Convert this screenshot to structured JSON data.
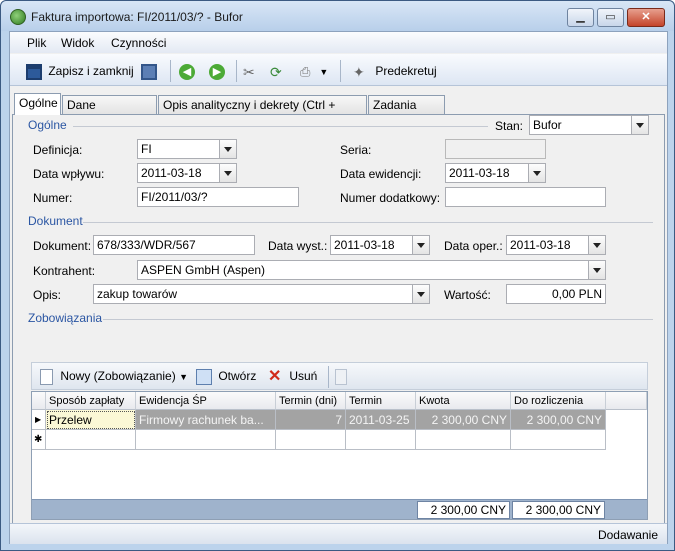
{
  "window": {
    "title": "Faktura importowa: FI/2011/03/? - Bufor"
  },
  "menu": {
    "file": "Plik",
    "view": "Widok",
    "actions": "Czynności"
  },
  "toolbar": {
    "save_close": "Zapisz i zamknij",
    "predecree": "Predekretuj"
  },
  "tabs": [
    {
      "label": "Ogólne"
    },
    {
      "label": "Dane kontrahenta"
    },
    {
      "label": "Opis analityczny i dekrety (Ctrl + Shift + D)"
    },
    {
      "label": "Zadania CRM"
    }
  ],
  "general": {
    "group_label": "Ogólne",
    "status_label": "Stan:",
    "status_value": "Bufor",
    "definition_label": "Definicja:",
    "definition_value": "FI",
    "series_label": "Seria:",
    "series_value": "",
    "receipt_date_label": "Data wpływu:",
    "receipt_date_value": "2011-03-18",
    "record_date_label": "Data ewidencji:",
    "record_date_value": "2011-03-18",
    "number_label": "Numer:",
    "number_value": "FI/2011/03/?",
    "extra_number_label": "Numer dodatkowy:",
    "extra_number_value": ""
  },
  "document": {
    "group_label": "Dokument",
    "doc_label": "Dokument:",
    "doc_value": "678/333/WDR/567",
    "issue_date_label": "Data wyst.:",
    "issue_date_value": "2011-03-18",
    "oper_date_label": "Data oper.:",
    "oper_date_value": "2011-03-18",
    "contractor_label": "Kontrahent:",
    "contractor_value": "ASPEN GmbH (Aspen)",
    "desc_label": "Opis:",
    "desc_value": "zakup towarów",
    "value_label": "Wartość:",
    "value_value": "0,00 PLN"
  },
  "obligations": {
    "group_label": "Zobowiązania",
    "new_label": "Nowy (Zobowiązanie)",
    "open_label": "Otwórz",
    "delete_label": "Usuń",
    "columns": [
      "Sposób zapłaty",
      "Ewidencja ŚP",
      "Termin (dni)",
      "Termin",
      "Kwota",
      "Do rozliczenia"
    ],
    "rows": [
      {
        "payment": "Przelew",
        "register": "Firmowy rachunek ba...",
        "days": "7",
        "due": "2011-03-25",
        "amount": "2 300,00 CNY",
        "to_settle": "2 300,00 CNY"
      }
    ],
    "total_amount": "2 300,00 CNY",
    "total_to_settle": "2 300,00 CNY"
  },
  "statusbar": {
    "mode": "Dodawanie"
  },
  "colors": {
    "accent": "#2b56a3",
    "selected_row": "#a3a3a3",
    "title_gradient": "#b8cfea"
  }
}
